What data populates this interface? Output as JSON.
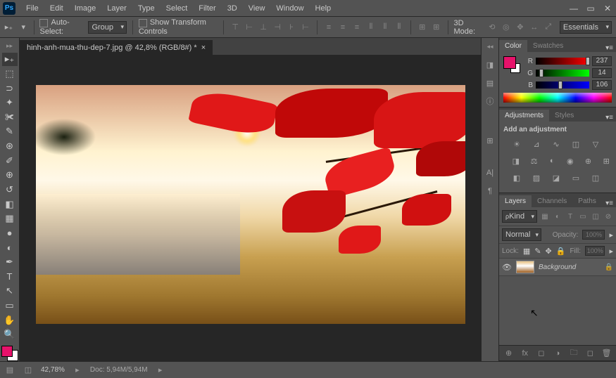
{
  "app": {
    "logo": "Ps"
  },
  "menu": [
    "File",
    "Edit",
    "Image",
    "Layer",
    "Type",
    "Select",
    "Filter",
    "3D",
    "View",
    "Window",
    "Help"
  ],
  "optionsBar": {
    "autoSelect": "Auto-Select:",
    "group": "Group",
    "showTransform": "Show Transform Controls",
    "mode3D": "3D Mode:",
    "workspace": "Essentials"
  },
  "document": {
    "tabTitle": "hinh-anh-mua-thu-dep-7.jpg @ 42,8% (RGB/8#) *"
  },
  "colorPanel": {
    "tabs": [
      "Color",
      "Swatches"
    ],
    "channels": [
      {
        "label": "R",
        "value": "237",
        "pos": 93
      },
      {
        "label": "G",
        "value": "14",
        "pos": 6
      },
      {
        "label": "B",
        "value": "106",
        "pos": 42
      }
    ]
  },
  "adjustments": {
    "tabs": [
      "Adjustments",
      "Styles"
    ],
    "title": "Add an adjustment"
  },
  "layers": {
    "tabs": [
      "Layers",
      "Channels",
      "Paths"
    ],
    "kind": "Kind",
    "blend": "Normal",
    "opacityLabel": "Opacity:",
    "opacity": "100%",
    "lockLabel": "Lock:",
    "fillLabel": "Fill:",
    "fill": "100%",
    "items": [
      {
        "name": "Background"
      }
    ]
  },
  "status": {
    "zoom": "42,78%",
    "doc": "Doc: 5,94M/5,94M"
  }
}
